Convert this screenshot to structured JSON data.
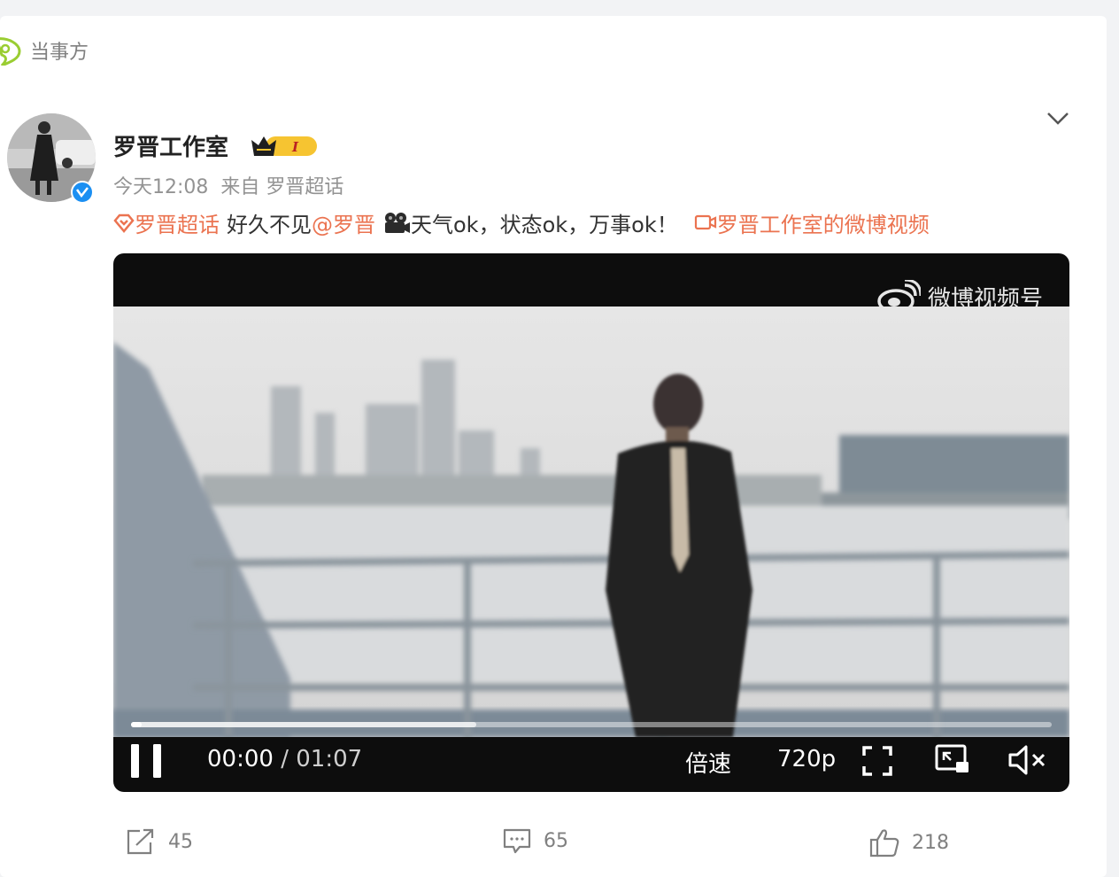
{
  "tag": {
    "label": "当事方",
    "icon": "topic-tag-icon"
  },
  "post": {
    "author": "罗晋工作室",
    "vip_badge": "I",
    "time": "今天12:08",
    "source": "来自 罗晋超话",
    "content": {
      "topic": "罗晋超话",
      "text1": "好久不见",
      "mention": "@罗晋",
      "text2": "天气ok，状态ok，万事ok！",
      "video_link": "罗晋工作室的微博视频"
    }
  },
  "video": {
    "watermark": "微博视频号",
    "current_time": "00:00",
    "duration": "01:07",
    "speed_label": "倍速",
    "quality_label": "720p",
    "buffered_fraction": 0.375,
    "played_fraction": 0.01
  },
  "actions": {
    "forward_count": "45",
    "comment_count": "65",
    "like_count": "218"
  },
  "colors": {
    "link": "#eb7350",
    "verified": "#1b8ff2",
    "tag": "#9acd32"
  }
}
